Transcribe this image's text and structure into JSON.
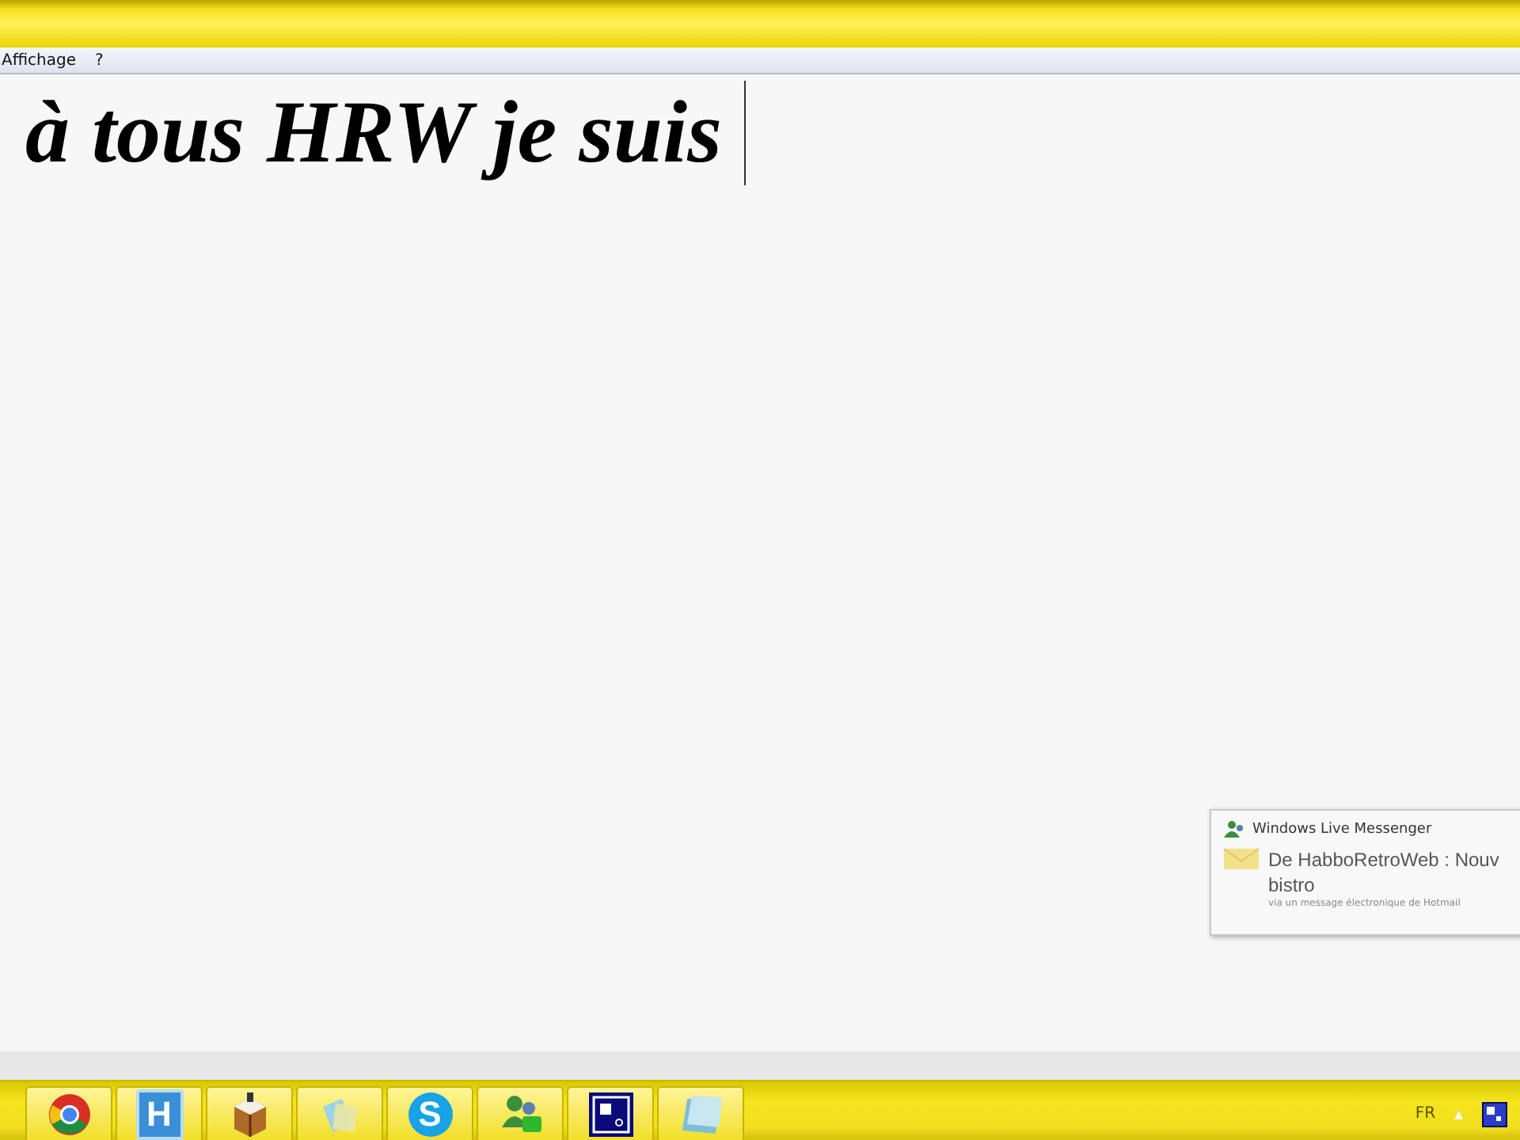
{
  "menu_bar": {
    "items": [
      {
        "label": "Affichage"
      },
      {
        "label": "?"
      }
    ]
  },
  "document": {
    "text": "à tous HRW je suis"
  },
  "notification": {
    "app": "Windows Live Messenger",
    "message": "De HabboRetroWeb : Nouv",
    "message_2": "bistro",
    "footer": "via un message électronique de Hotmail"
  },
  "taskbar": {
    "buttons": [
      {
        "kind": "browser"
      },
      {
        "kind": "letter",
        "glyph": "H"
      },
      {
        "kind": "box"
      },
      {
        "kind": "cards"
      },
      {
        "kind": "chat",
        "glyph": "S"
      },
      {
        "kind": "people"
      },
      {
        "kind": "window"
      },
      {
        "kind": "notepad"
      }
    ],
    "tray": {
      "language": "FR",
      "arrow": "▲"
    }
  }
}
